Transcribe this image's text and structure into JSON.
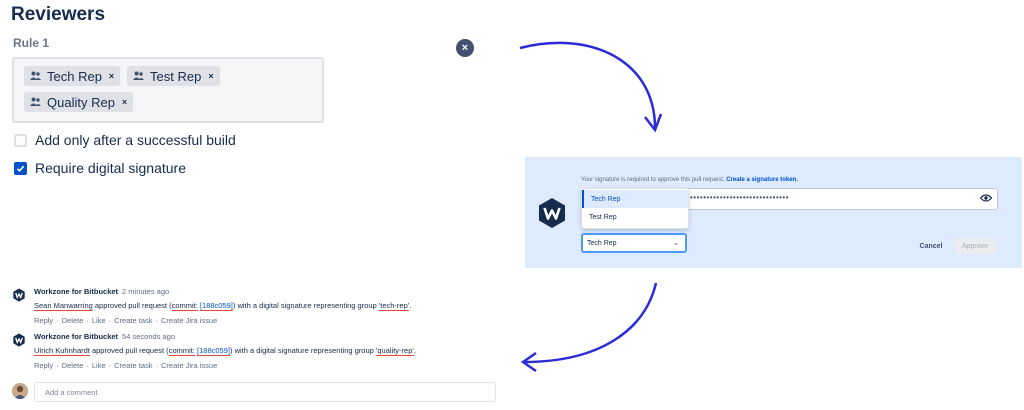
{
  "reviewers": {
    "title": "Reviewers",
    "rule_label": "Rule 1",
    "chips": [
      {
        "label": "Tech Rep",
        "remove": "×"
      },
      {
        "label": "Test Rep",
        "remove": "×"
      },
      {
        "label": "Quality Rep",
        "remove": "×"
      }
    ],
    "close_glyph": "×",
    "options": [
      {
        "label": "Add only after a successful build",
        "checked": false
      },
      {
        "label": "Require digital signature",
        "checked": true
      }
    ]
  },
  "signature": {
    "message": "Your signature is required to approve this pull request.",
    "message_link": "Create a signature token.",
    "token_dots": "••••••••••••••••••••••••••••••",
    "dropdown_options": [
      "Tech Rep",
      "Test Rep"
    ],
    "selected_option": "Tech Rep",
    "selected_value": "Tech Rep",
    "cancel_label": "Cancel",
    "approve_label": "Approve",
    "accent": "#0052cc"
  },
  "activity": [
    {
      "author": "Workzone for Bitbucket",
      "time": "2 minutes ago",
      "user": "Sean Manwarring",
      "text_before": "approved pull request (",
      "commit_label": "commit:",
      "commit": "[188c059]",
      "text_after": ") with a digital signature representing group",
      "group": "'tech-rep'",
      "end": ".",
      "actions": [
        "Reply",
        "Delete",
        "Like",
        "Create task",
        "Create Jira issue"
      ]
    },
    {
      "author": "Workzone for Bitbucket",
      "time": "54 seconds ago",
      "user": "Ulrich Kuhnhardt",
      "text_before": "approved pull request (",
      "commit_label": "commit:",
      "commit": "[188c059]",
      "text_after": ") with a digital signature representing group",
      "group": "'quality-rep'",
      "end": ".",
      "actions": [
        "Reply",
        "Delete",
        "Like",
        "Create task",
        "Create Jira issue"
      ]
    }
  ],
  "comment": {
    "placeholder": "Add a comment"
  },
  "icons": {
    "group": "group-icon",
    "close": "close-icon",
    "eye": "eye-icon",
    "logo": "workzone-logo-icon",
    "chevron": "chevron-down-icon",
    "arrow": "curved-arrow-icon"
  },
  "colors": {
    "arrow": "#2b2bd8",
    "underline": "#e5493a",
    "panel": "#deebff"
  }
}
